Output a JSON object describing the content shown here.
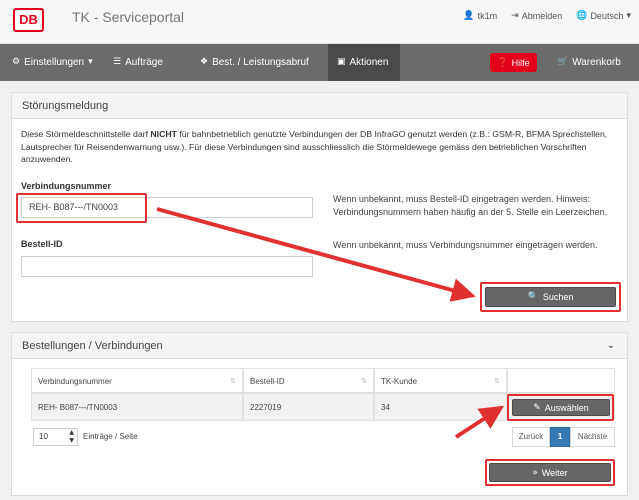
{
  "header": {
    "logo_text": "DB",
    "title": "TK - Serviceportal",
    "user": "tk1m",
    "logout": "Abmelden",
    "language": "Deutsch"
  },
  "nav": {
    "settings": "Einstellungen",
    "orders": "Aufträge",
    "service_call": "Best. / Leistungsabruf",
    "actions": "Aktionen",
    "help": "Hilfe",
    "cart": "Warenkorb"
  },
  "stoerung": {
    "heading": "Störungsmeldung",
    "info_part1": "Diese Störmeldeschnittstelle darf ",
    "info_bold": "NICHT",
    "info_part2": " für bahnbetrieblich genutzte Verbindungen der DB InfraGO genutzt werden (z.B.: GSM-R, BFMA Sprechstellen, Lautsprecher für Reisendenwarnung usw.). Für diese Verbindungen sind ausschliesslich die Störmeldewege gemäss den betrieblichen Vorschriften anzuwenden.",
    "conn_label": "Verbindungsnummer",
    "conn_value": "REH- B087---/TN0003",
    "conn_hint": "Wenn unbekannt, muss Bestell-ID eingetragen werden. Hinweis: Verbindungsnummern haben häufig an der 5. Stelle ein Leerzeichen.",
    "order_label": "Bestell-ID",
    "order_value": "",
    "order_hint": "Wenn unbekannt, muss Verbindungsnummer eingetragen werden.",
    "search_button": "Suchen"
  },
  "orders": {
    "heading": "Bestellungen / Verbindungen",
    "columns": [
      "Verbindungsnummer",
      "Bestell-ID",
      "TK-Kunde"
    ],
    "rows": [
      {
        "conn": "REH- B087---/TN0003",
        "order_id": "2227019",
        "customer": "34"
      }
    ],
    "select_button": "Auswählen",
    "page_size": "10",
    "per_page_label": "Einträge / Seite",
    "prev": "Zurück",
    "page": "1",
    "next": "Nächste",
    "next_step_button": "Weiter"
  },
  "colors": {
    "brand_red": "#e2001a",
    "nav_bg": "#6b6b6b",
    "annotation_red": "#e03030",
    "pager_active": "#337ab7"
  }
}
